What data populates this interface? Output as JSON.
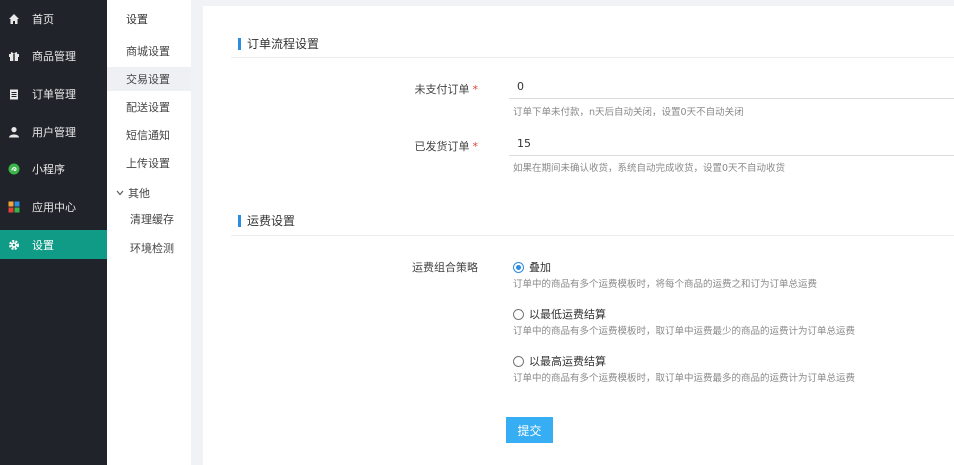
{
  "sidebar": {
    "items": [
      {
        "label": "首页",
        "icon": "home-icon"
      },
      {
        "label": "商品管理",
        "icon": "gift-icon"
      },
      {
        "label": "订单管理",
        "icon": "clipboard-icon"
      },
      {
        "label": "用户管理",
        "icon": "user-icon"
      },
      {
        "label": "小程序",
        "icon": "miniprogram-icon"
      },
      {
        "label": "应用中心",
        "icon": "apps-icon"
      },
      {
        "label": "设置",
        "icon": "gear-icon"
      }
    ],
    "active_color": "#0f9b85"
  },
  "submenu": {
    "title": "设置",
    "items": [
      "商城设置",
      "交易设置",
      "配送设置",
      "短信通知",
      "上传设置"
    ],
    "group_label": "其他",
    "group_children": [
      "清理缓存",
      "环境检测"
    ]
  },
  "order_section": {
    "title": "订单流程设置",
    "unpaid_label": "未支付订单",
    "unpaid_value": "0",
    "unpaid_help": "订单下单未付款，n天后自动关闭，设置0天不自动关闭",
    "shipped_label": "已发货订单",
    "shipped_value": "15",
    "shipped_help": "如果在期间未确认收货，系统自动完成收货，设置0天不自动收货",
    "required_mark": "*"
  },
  "freight_section": {
    "title": "运费设置",
    "strategy_label": "运费组合策略",
    "options": [
      {
        "label": "叠加",
        "help": "订单中的商品有多个运费模板时，将每个商品的运费之和订为订单总运费",
        "checked": true
      },
      {
        "label": "以最低运费结算",
        "help": "订单中的商品有多个运费模板时，取订单中运费最少的商品的运费计为订单总运费",
        "checked": false
      },
      {
        "label": "以最高运费结算",
        "help": "订单中的商品有多个运费模板时，取订单中运费最多的商品的运费计为订单总运费",
        "checked": false
      }
    ]
  },
  "submit_label": "提交",
  "accent_color": "#37aef3"
}
